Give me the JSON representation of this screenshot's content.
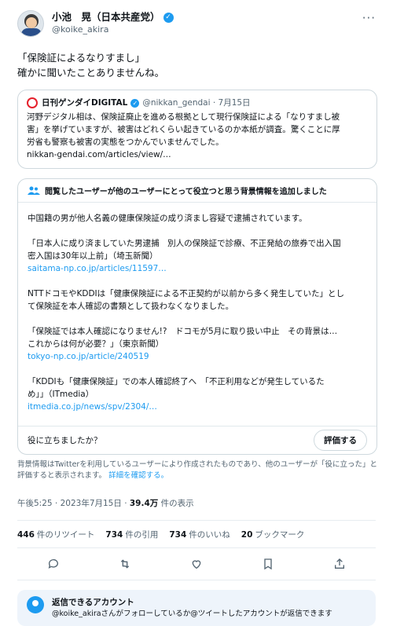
{
  "author": {
    "name": "小池　晃（日本共産党）",
    "handle": "@koike_akira"
  },
  "more_icon": "more-horizontal-icon",
  "tweet_text": [
    "「保険証によるなりすまし」",
    "確かに聞いたことありませんね。"
  ],
  "quote": {
    "name": "日刊ゲンダイDIGITAL",
    "handle": "@nikkan_gendai",
    "date": "7月15日",
    "text": [
      "河野デジタル相は、保険証廃止を進める根拠として現行保険証による「なりすまし被",
      "害」を挙げていますが、被害はどれくらい起きているのか本紙が調査。驚くことに厚",
      "労省も警察も被害の実態をつかんでいませんでした。",
      "nikkan-gendai.com/articles/view/…"
    ]
  },
  "community_note": {
    "heading": "閲覧したユーザーが他のユーザーにとって役立つと思う背景情報を追加しました",
    "paragraphs": [
      {
        "lines": [
          "中国籍の男が他人名義の健康保険証の成り済まし容疑で逮捕されています。"
        ],
        "link": ""
      },
      {
        "lines": [
          "「日本人に成り済ましていた男逮捕　別人の保険証で診療、不正発給の旅券で出入国",
          "密入国は30年以上前」（埼玉新聞）"
        ],
        "link": "saitama-np.co.jp/articles/11597…"
      },
      {
        "lines": [
          "NTTドコモやKDDIは「健康保険証による不正契約が以前から多く発生していた」とし",
          "て保険証を本人確認の書類として扱わなくなりました。"
        ],
        "link": ""
      },
      {
        "lines": [
          "「保険証では本人確認になりません!?　ドコモが5月に取り扱い中止　その背景は…",
          "これからは何が必要？」（東京新聞）"
        ],
        "link": "tokyo-np.co.jp/article/240519"
      },
      {
        "lines": [
          "「KDDIも「健康保険証」での本人確認終了へ　「不正利用などが発生しているた",
          "め」」（ITmedia）"
        ],
        "link": "itmedia.co.jp/news/spv/2304/…"
      }
    ],
    "helpful_question": "役に立ちましたか？",
    "rate_button": "評価する"
  },
  "disclaimer": {
    "text": "背景情報はTwitterを利用しているユーザーにより作成されたものであり、他のユーザーが「役に立った」と評価すると表示されます。",
    "learn_more": "詳細を確認する。"
  },
  "timestamp": {
    "time_date": "午後5:25 · 2023年7月15日 · ",
    "views_count": "39.4万",
    "views_label": " 件の表示"
  },
  "stats": [
    {
      "count": "446",
      "label": "件のリツイート"
    },
    {
      "count": "734",
      "label": "件の引用"
    },
    {
      "count": "734",
      "label": "件のいいね"
    },
    {
      "count": "20",
      "label": "ブックマーク"
    }
  ],
  "actions": [
    "reply-icon",
    "retweet-icon",
    "like-icon",
    "bookmark-icon",
    "share-icon"
  ],
  "reply_restriction": {
    "title": "返信できるアカウント",
    "description": "@koike_akiraさんがフォローしているか@ツイートしたアカウントが返信できます"
  },
  "colors": {
    "accent": "#1d9bf0",
    "text": "#0f1419",
    "muted": "#536471",
    "border": "#cfd9de"
  }
}
